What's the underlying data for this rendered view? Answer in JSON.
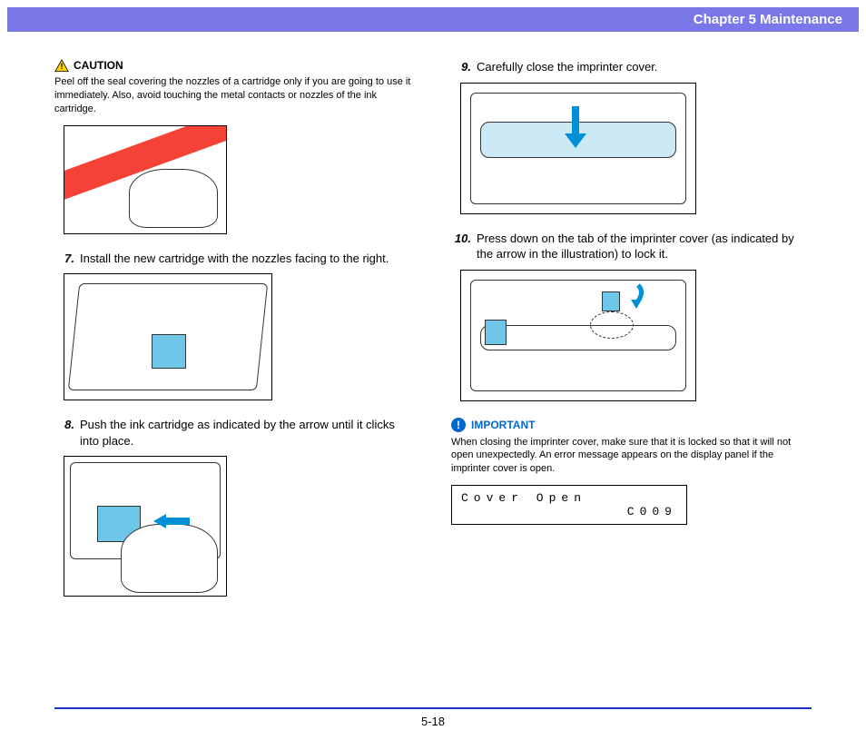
{
  "header": {
    "chapter": "Chapter 5   Maintenance"
  },
  "caution": {
    "label": "CAUTION",
    "text": "Peel off the seal covering the nozzles of a cartridge only if you are going to use it immediately. Also, avoid touching the metal contacts or nozzles of the ink cartridge."
  },
  "steps": {
    "s7": {
      "num": "7.",
      "text": "Install the new cartridge with the nozzles facing to the right."
    },
    "s8": {
      "num": "8.",
      "text": "Push the ink cartridge as indicated by the arrow until it clicks into place."
    },
    "s9": {
      "num": "9.",
      "text": "Carefully close the imprinter cover."
    },
    "s10": {
      "num": "10.",
      "text": "Press down on the tab of the imprinter cover (as indicated by the arrow in the illustration) to lock it."
    }
  },
  "important": {
    "label": "IMPORTANT",
    "text": "When closing the imprinter cover, make sure that it is locked so that it will not open unexpectedly. An error message appears on the display panel if the imprinter cover is open."
  },
  "lcd": {
    "line1": "Cover Open",
    "line2": "C009"
  },
  "footer": {
    "page": "5-18"
  }
}
